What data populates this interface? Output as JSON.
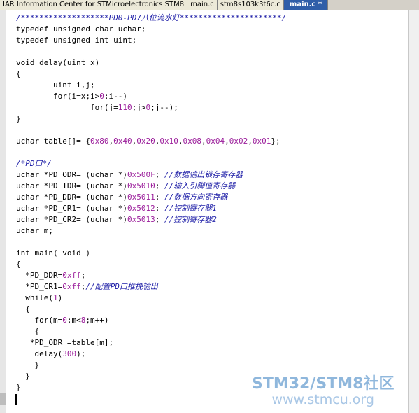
{
  "tabs": [
    {
      "label": "IAR Information Center for STMicroelectronics STM8"
    },
    {
      "label": "main.c"
    },
    {
      "label": "stm8s103k3t6c.c"
    },
    {
      "label": "main.c *"
    }
  ],
  "code_lines": [
    "/*******************PD0-PD7八位流水灯**********************/",
    "typedef unsigned char uchar;",
    "typedef unsigned int uint;",
    "",
    "void delay(uint x)",
    "{",
    "        uint i,j;",
    "        for(i=x;i>0;i--)",
    "                for(j=110;j>0;j--);",
    "}",
    "",
    "uchar table[]= {0x80,0x40,0x20,0x10,0x08,0x04,0x02,0x01};",
    "",
    "/*PD口*/",
    "uchar *PD_ODR= (uchar *)0x500F; //数据输出锁存寄存器",
    "uchar *PD_IDR= (uchar *)0x5010; //输入引脚值寄存器",
    "uchar *PD_DDR= (uchar *)0x5011; //数据方向寄存器",
    "uchar *PD_CR1= (uchar *)0x5012; //控制寄存器1",
    "uchar *PD_CR2= (uchar *)0x5013; //控制寄存器2",
    "uchar m;",
    "",
    "int main( void )",
    "{",
    "  *PD_DDR=0xff;",
    "  *PD_CR1=0xff;//配置PD口推挽输出",
    "  while(1)",
    "  {",
    "    for(m=0;m<8;m++)",
    "    {",
    "   *PD_ODR =table[m];",
    "    delay(300);",
    "    }",
    "  }",
    "}",
    ""
  ],
  "watermark": {
    "line1": "STM32/STM8社区",
    "line2": "www.stmcu.org"
  },
  "colors": {
    "keyword": "#000080",
    "number": "#9b1e9b",
    "comment": "#2020a8",
    "active_tab": "#2f5ea8"
  }
}
